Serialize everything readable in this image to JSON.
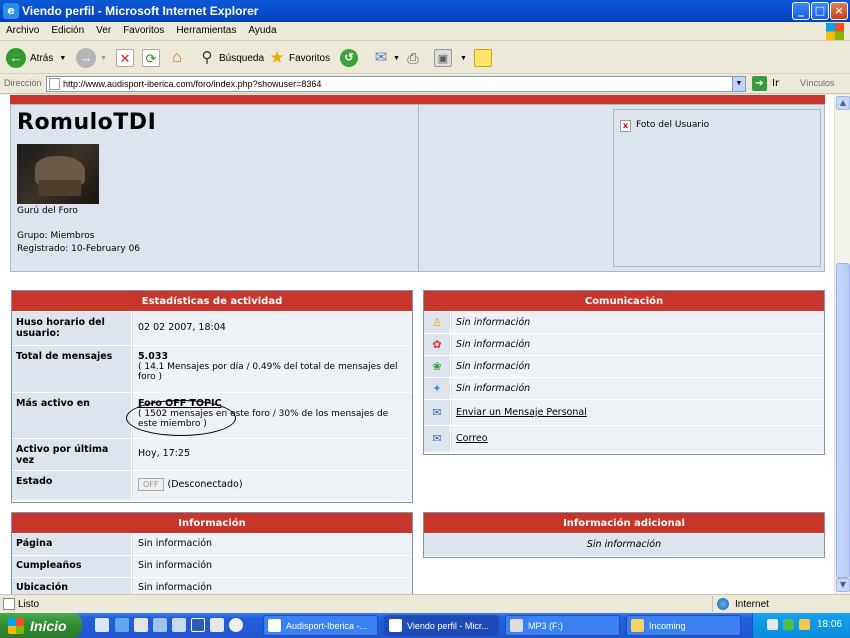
{
  "window": {
    "title": "Viendo perfil - Microsoft Internet Explorer",
    "buttons": {
      "minimize": "_",
      "maximize": "□",
      "close": "×"
    }
  },
  "menu": [
    "Archivo",
    "Edición",
    "Ver",
    "Favoritos",
    "Herramientas",
    "Ayuda"
  ],
  "toolbar": {
    "back": "Atrás",
    "search": "Búsqueda",
    "favorites": "Favoritos"
  },
  "address": {
    "label": "Dirección",
    "url": "http://www.audisport-iberica.com/foro/index.php?showuser=8364",
    "go": "Ir",
    "links": "Vínculos"
  },
  "profile": {
    "username": "RomuloTDI",
    "rank": "Gurú del Foro",
    "group": "Grupo: Miembros",
    "registered": "Registrado: 10-February 06",
    "photo_alt": "Foto del Usuario"
  },
  "stats": {
    "title": "Estadísticas de actividad",
    "timezone_label": "Huso horario del usuario:",
    "timezone_value": "02 02 2007, 18:04",
    "posts_label": "Total de mensajes",
    "posts_value": "5.033",
    "posts_detail": "( 14.1 Mensajes por día / 0.49% del total de mensajes del foro )",
    "active_in_label": "Más activo en",
    "active_in_value": "Foro OFF TOPIC",
    "active_in_detail": "( 1502 mensajes en este foro / 30% de los mensajes de este miembro )",
    "last_active_label": "Activo por última vez",
    "last_active_value": "Hoy, 17:25",
    "state_label": "Estado",
    "state_badge": "OFF",
    "state_value": "(Desconectado)"
  },
  "comm": {
    "title": "Comunicación",
    "items": [
      {
        "icon": "aim-icon",
        "text": "Sin información"
      },
      {
        "icon": "msn-icon",
        "text": "Sin información"
      },
      {
        "icon": "icq-icon",
        "text": "Sin información"
      },
      {
        "icon": "yahoo-icon",
        "text": "Sin información"
      },
      {
        "icon": "envelope-icon",
        "text": "Enviar un Mensaje Personal"
      },
      {
        "icon": "envelope-icon",
        "text": "Correo"
      }
    ]
  },
  "info": {
    "title": "Información",
    "rows": [
      {
        "label": "Página",
        "value": "Sin información"
      },
      {
        "label": "Cumpleaños",
        "value": "Sin información"
      },
      {
        "label": "Ubicación",
        "value": "Sin información"
      }
    ]
  },
  "extra": {
    "title": "Información adicional",
    "value": "Sin información"
  },
  "status": {
    "text": "Listo",
    "zone": "Internet"
  },
  "taskbar": {
    "start": "Inicio",
    "tasks": [
      "Audisport-Iberica -...",
      "Viendo perfil - Micr...",
      "MP3 (F:)",
      "Incoming"
    ],
    "clock": "18:06"
  }
}
